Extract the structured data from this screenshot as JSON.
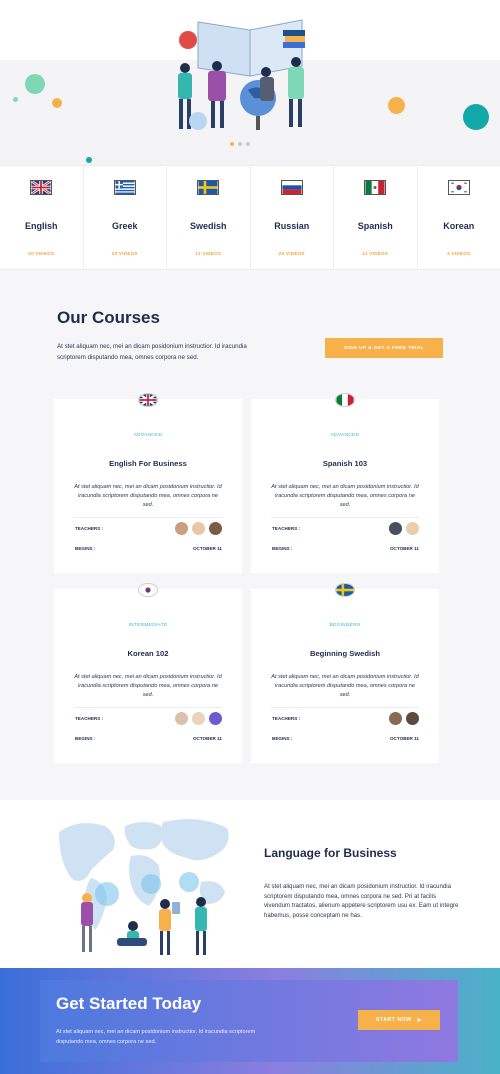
{
  "languages": [
    {
      "name": "English",
      "videos": "20 VIDEOS",
      "flag": "uk-flag"
    },
    {
      "name": "Greek",
      "videos": "20 VIDEOS",
      "flag": "greece-flag"
    },
    {
      "name": "Swedish",
      "videos": "12 VIDEOS",
      "flag": "sweden-flag"
    },
    {
      "name": "Russian",
      "videos": "20 VIDEOS",
      "flag": "russia-flag"
    },
    {
      "name": "Spanish",
      "videos": "12 VIDEOS",
      "flag": "mexico-flag"
    },
    {
      "name": "Korean",
      "videos": "4 VIDEOS",
      "flag": "korea-flag"
    }
  ],
  "courses_section": {
    "title": "Our Courses",
    "description": "At stet aliquam nec, mei an dicam posidonium instructior. Id iracundia scriptorem disputando mea, omnes corpora ne sed.",
    "signup_label": "SIGN UP & GET A FREE TRIAL"
  },
  "courses": [
    {
      "level": "ADVANCED",
      "title": "English For Business",
      "description": "At stet aliquam nec, mei an dicam posidonium instructior. Id iracundia scriptorem disputando mea, omnes corpora ne sed.",
      "teachers_label": "TEACHERS :",
      "begins_label": "BEGINS :",
      "begins_date": "OCTOBER 11"
    },
    {
      "level": "ADVANCED",
      "title": "Spanish 103",
      "description": "At stet aliquam nec, mei an dicam posidonium instructior. Id iracundia scriptorem disputando mea, omnes corpora ne sed.",
      "teachers_label": "TEACHERS :",
      "begins_label": "BEGINS :",
      "begins_date": "OCTOBER 11"
    },
    {
      "level": "INTERMEDIATE",
      "title": "Korean 102",
      "description": "At stet aliquam nec, mei an dicam posidonium instructior. Id iracundia scriptorem disputando mea, omnes corpora ne sed.",
      "teachers_label": "TEACHERS :",
      "begins_label": "BEGINS :",
      "begins_date": "OCTOBER 11"
    },
    {
      "level": "BEGINNERS",
      "title": "Beginning Swedish",
      "description": "At stet aliquam nec, mei an dicam posidonium instructior. Id iracundia scriptorem disputando mea, omnes corpora ne sed.",
      "teachers_label": "TEACHERS :",
      "begins_label": "BEGINS :",
      "begins_date": "OCTOBER 11"
    }
  ],
  "business": {
    "title": "Language for Business",
    "description": "At stet aliquam nec, mei an dicam posidonium instructior. Id iracundia scriptorem disputando mea, omnes corpora ne sed. Pri at facilis vivendum tractatos, alienum appetere scriptorem usu ex. Eam ut integre habemus, posse conceptam ne has."
  },
  "cta": {
    "title": "Get Started Today",
    "description": "At stet aliquam nec, mei an dicam posidonium instructior. Id iracundia scriptorem disputando mea, omnes corpora ne sed.",
    "button_label": "START NOW"
  },
  "colors": {
    "accent": "#f7b14a",
    "teal": "#3bb4c7",
    "navy": "#1f2d4d"
  }
}
